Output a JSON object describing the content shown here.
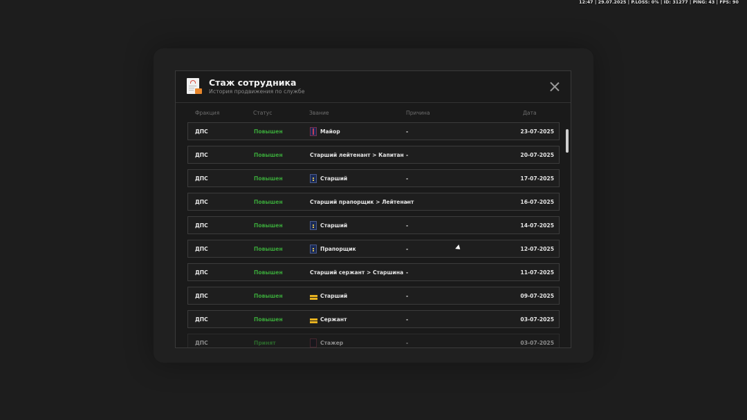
{
  "hud": {
    "text": "12:47 | 29.07.2025 | P.LOSS: 0% | ID: 31277 | PING: 43 | FPS: 90"
  },
  "modal": {
    "title": "Стаж сотрудника",
    "subtitle": "История продвижения по службе",
    "columns": {
      "faction": "Фракция",
      "status": "Статус",
      "rank": "Звание",
      "reason": "Причина",
      "date": "Дата"
    },
    "rows": [
      {
        "faction": "ДПС",
        "status": "Повышен",
        "rank": "Майор",
        "icon": "major-insignia-icon",
        "reason": "-",
        "date": "23-07-2025"
      },
      {
        "faction": "ДПС",
        "status": "Повышен",
        "rank": "Старший лейтенант > Капитан",
        "icon": "",
        "reason": "-",
        "date": "20-07-2025"
      },
      {
        "faction": "ДПС",
        "status": "Повышен",
        "rank": "Старший",
        "icon": "officer-insignia-icon",
        "reason": "-",
        "date": "17-07-2025"
      },
      {
        "faction": "ДПС",
        "status": "Повышен",
        "rank": "Старший прапорщик > Лейтенант",
        "icon": "",
        "reason": "-",
        "date": "16-07-2025"
      },
      {
        "faction": "ДПС",
        "status": "Повышен",
        "rank": "Старший",
        "icon": "warrant-insignia-icon",
        "reason": "-",
        "date": "14-07-2025"
      },
      {
        "faction": "ДПС",
        "status": "Повышен",
        "rank": "Прапорщик",
        "icon": "warrant-insignia-icon",
        "reason": "-",
        "date": "12-07-2025"
      },
      {
        "faction": "ДПС",
        "status": "Повышен",
        "rank": "Старший сержант > Старшина",
        "icon": "",
        "reason": "-",
        "date": "11-07-2025"
      },
      {
        "faction": "ДПС",
        "status": "Повышен",
        "rank": "Старший",
        "icon": "stripes-insignia-icon",
        "reason": "-",
        "date": "09-07-2025"
      },
      {
        "faction": "ДПС",
        "status": "Повышен",
        "rank": "Сержант",
        "icon": "stripes-insignia-icon",
        "reason": "-",
        "date": "03-07-2025"
      },
      {
        "faction": "ДПС",
        "status": "Принят",
        "rank": "Стажер",
        "icon": "trainee-insignia-icon",
        "reason": "-",
        "date": "03-07-2025"
      }
    ]
  },
  "colors": {
    "background": "#1d1d1d",
    "modal": "#1a1a1a",
    "status_green": "#3aa63a",
    "accent_orange": "#e8862b"
  }
}
